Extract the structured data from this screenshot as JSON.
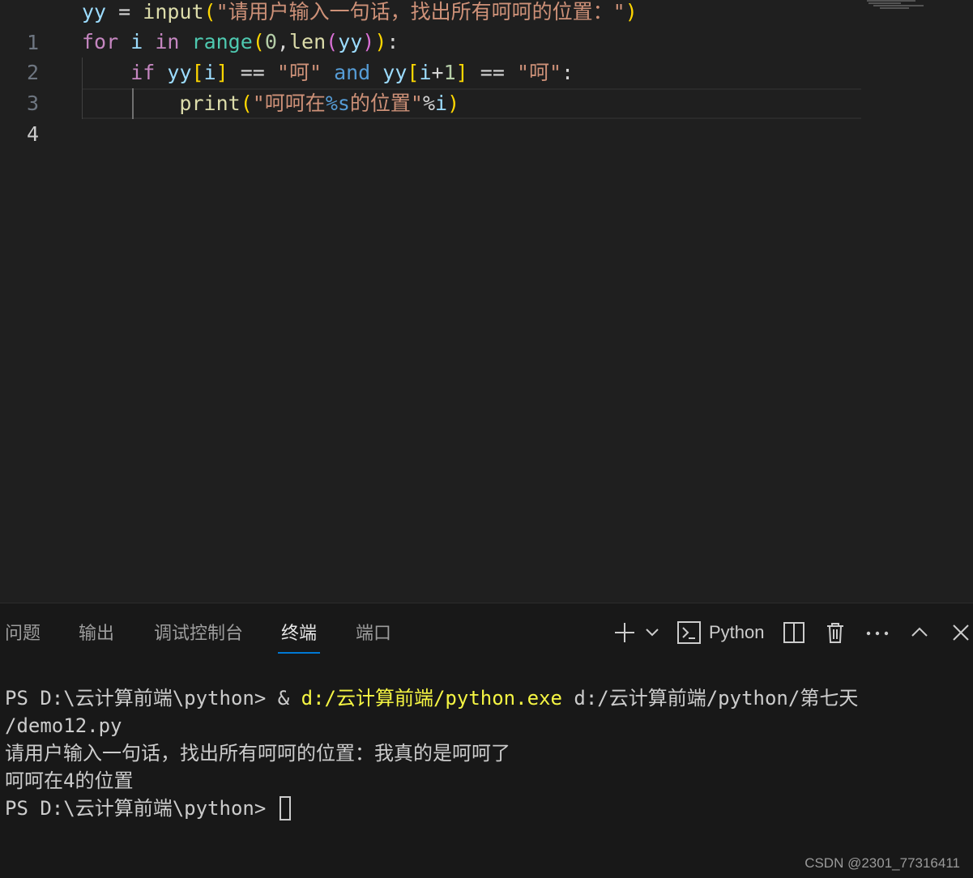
{
  "editor": {
    "line_numbers": [
      "1",
      "2",
      "3",
      "4"
    ],
    "active_line": "4",
    "lines": [
      {
        "tokens": [
          {
            "t": "yy",
            "c": "var"
          },
          {
            "t": " = ",
            "c": "op"
          },
          {
            "t": "input",
            "c": "fn"
          },
          {
            "t": "(",
            "c": "br1"
          },
          {
            "t": "\"请用户输入一句话，找出所有呵呵的位置：\"",
            "c": "str"
          },
          {
            "t": ")",
            "c": "br1"
          }
        ]
      },
      {
        "tokens": [
          {
            "t": "for",
            "c": "kw"
          },
          {
            "t": " ",
            "c": "op"
          },
          {
            "t": "i",
            "c": "var"
          },
          {
            "t": " ",
            "c": "op"
          },
          {
            "t": "in",
            "c": "kw"
          },
          {
            "t": " ",
            "c": "op"
          },
          {
            "t": "range",
            "c": "bi"
          },
          {
            "t": "(",
            "c": "br1"
          },
          {
            "t": "0",
            "c": "num"
          },
          {
            "t": ",",
            "c": "op"
          },
          {
            "t": "len",
            "c": "fn"
          },
          {
            "t": "(",
            "c": "br2"
          },
          {
            "t": "yy",
            "c": "var"
          },
          {
            "t": ")",
            "c": "br2"
          },
          {
            "t": ")",
            "c": "br1"
          },
          {
            "t": ":",
            "c": "op"
          }
        ]
      },
      {
        "tokens": [
          {
            "t": "    ",
            "c": "op"
          },
          {
            "t": "if",
            "c": "kw"
          },
          {
            "t": " ",
            "c": "op"
          },
          {
            "t": "yy",
            "c": "var"
          },
          {
            "t": "[",
            "c": "br1"
          },
          {
            "t": "i",
            "c": "var"
          },
          {
            "t": "]",
            "c": "br1"
          },
          {
            "t": " == ",
            "c": "op"
          },
          {
            "t": "\"呵\"",
            "c": "str"
          },
          {
            "t": " ",
            "c": "op"
          },
          {
            "t": "and",
            "c": "kw2"
          },
          {
            "t": " ",
            "c": "op"
          },
          {
            "t": "yy",
            "c": "var"
          },
          {
            "t": "[",
            "c": "br1"
          },
          {
            "t": "i",
            "c": "var"
          },
          {
            "t": "+",
            "c": "op"
          },
          {
            "t": "1",
            "c": "num"
          },
          {
            "t": "]",
            "c": "br1"
          },
          {
            "t": " == ",
            "c": "op"
          },
          {
            "t": "\"呵\"",
            "c": "str"
          },
          {
            "t": ":",
            "c": "op"
          }
        ]
      },
      {
        "tokens": [
          {
            "t": "        ",
            "c": "op"
          },
          {
            "t": "print",
            "c": "fn"
          },
          {
            "t": "(",
            "c": "br1"
          },
          {
            "t": "\"呵呵在",
            "c": "str"
          },
          {
            "t": "%s",
            "c": "kw2"
          },
          {
            "t": "的位置\"",
            "c": "str"
          },
          {
            "t": "%",
            "c": "op"
          },
          {
            "t": "i",
            "c": "var"
          },
          {
            "t": ")",
            "c": "br1"
          }
        ]
      }
    ]
  },
  "panel": {
    "tabs": [
      {
        "label": "问题",
        "active": false
      },
      {
        "label": "输出",
        "active": false
      },
      {
        "label": "调试控制台",
        "active": false
      },
      {
        "label": "终端",
        "active": true
      },
      {
        "label": "端口",
        "active": false
      }
    ],
    "actions": {
      "new_terminal_icon": "plus-icon",
      "dropdown_icon": "chevron-down-icon",
      "terminal_profile_icon": "terminal-icon",
      "terminal_profile_label": "Python",
      "split_icon": "split-editor-icon",
      "kill_icon": "trash-icon",
      "more_icon": "ellipsis-icon",
      "maximize_icon": "chevron-up-icon",
      "close_icon": "close-icon"
    },
    "terminal": {
      "line1_prompt": "PS D:\\云计算前端\\python> & ",
      "line1_exe": "d:/云计算前端/python.exe",
      "line1_arg": " d:/云计算前端/python/第七天",
      "line2": "/demo12.py",
      "line3": "请用户输入一句话，找出所有呵呵的位置：我真的是呵呵了",
      "line4": "呵呵在4的位置",
      "line5_prompt": "PS D:\\云计算前端\\python> "
    }
  },
  "watermark": "CSDN @2301_77316411",
  "colors": {
    "accent": "#0078d4",
    "background": "#1f1f1f",
    "panel": "#181818"
  }
}
